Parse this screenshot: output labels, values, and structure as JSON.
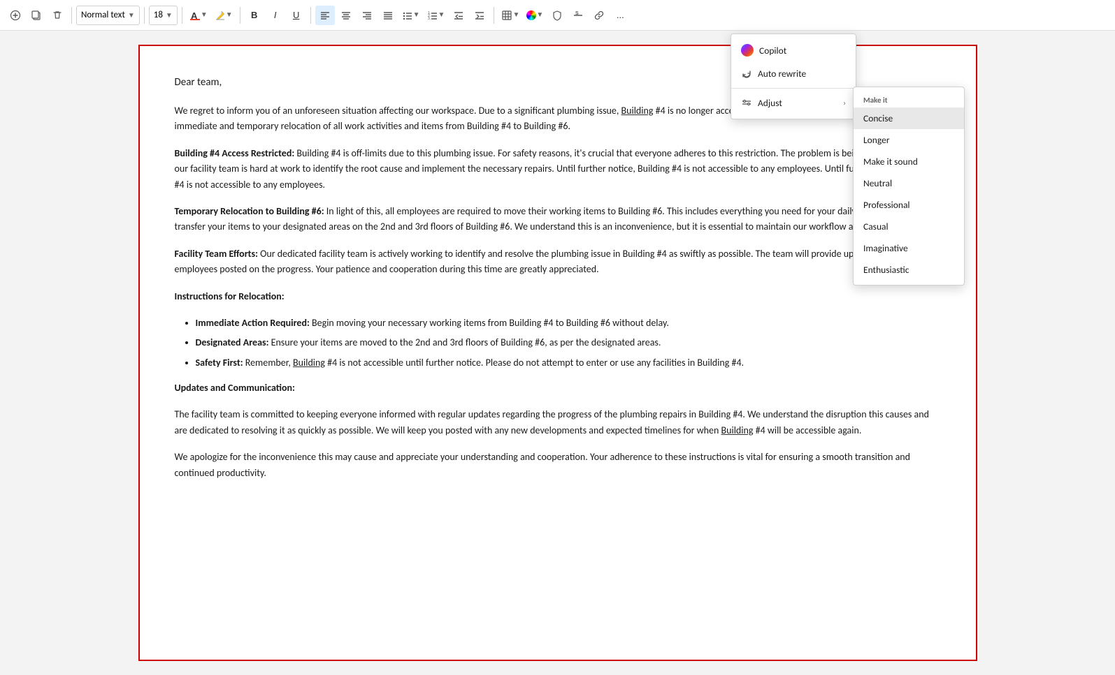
{
  "toolbar": {
    "style_label": "Normal text",
    "font_size": "18",
    "bold_label": "B",
    "italic_label": "I",
    "underline_label": "U",
    "more_label": "..."
  },
  "copilot_menu": {
    "copilot_label": "Copilot",
    "auto_rewrite_label": "Auto rewrite",
    "adjust_label": "Adjust",
    "make_it_label": "Make it"
  },
  "makeit_submenu": {
    "header": "Make it",
    "items": [
      {
        "label": "Concise",
        "selected": true
      },
      {
        "label": "Longer",
        "selected": false
      },
      {
        "label": "Make it sound",
        "selected": false
      },
      {
        "label": "Neutral",
        "selected": false
      },
      {
        "label": "Professional",
        "selected": false
      },
      {
        "label": "Casual",
        "selected": false
      },
      {
        "label": "Imaginative",
        "selected": false
      },
      {
        "label": "Enthusiastic",
        "selected": false
      }
    ]
  },
  "document": {
    "greeting": "Dear team,",
    "para1": "We regret to inform you of an unforeseen situation affecting our workspace. Due to a significant plumbing issue, Building #4 is no longer accessible. This unforeseen problem has necessitated an immediate and temporary relocation of all work activities and items from Building #4 to Building #6.",
    "section1_title": "Building #4 Access Restricted:",
    "section1_body": " Building #4 is off-limits due to this plumbing issue. For safety reasons, it's crucial that everyone adheres to this restriction. The problem is being investigated, and our facility team is hard at work to identify the root cause and implement the necessary repairs. Until further notice, Building #4 is not accessible to any employees.",
    "section2_title": "Temporary Relocation to Building #6:",
    "section2_body": " In light of this, all employees are required to move their working items to Building #6. This includes everything you need for your daily tasks. You should transfer your items to your designated areas on the 2nd and 3rd floors of Building #6. We understand this is an inconvenience, but it is essential to maintain our workflow and productivity.",
    "section3_title": "Facility Team Efforts:",
    "section3_body": " Our dedicated facility team is actively working to identify and resolve the plumbing issue in Building #4 as swiftly as possible. The team will provide updates and keep all employees posted on the progress. Your patience and cooperation during this time are greatly appreciated.",
    "instructions_title": "Instructions for Relocation:",
    "bullet1_title": "Immediate Action Required:",
    "bullet1_body": " Begin moving your necessary working items from Building #4 to Building #6 without delay.",
    "bullet2_title": "Designated Areas:",
    "bullet2_body": " Ensure your items are moved to the 2nd and 3rd floors of Building #6, as per the designated areas.",
    "bullet3_title": "Safety First:",
    "bullet3_body": " Remember, Building #4 is not accessible until further notice. Please do not attempt to enter or use any facilities in Building #4.",
    "updates_title": "Updates and Communication:",
    "updates_body": "The facility team is committed to keeping everyone informed with regular updates regarding the progress of the plumbing repairs in Building #4. We understand the disruption this causes and are dedicated to resolving it as quickly as possible. We will keep you posted with any new developments and expected timelines for when Building #4 will be accessible again.",
    "closing": "We apologize for the inconvenience this may cause and appreciate your understanding and cooperation. Your adherence to these instructions is vital for ensuring a smooth transition and continued productivity."
  }
}
